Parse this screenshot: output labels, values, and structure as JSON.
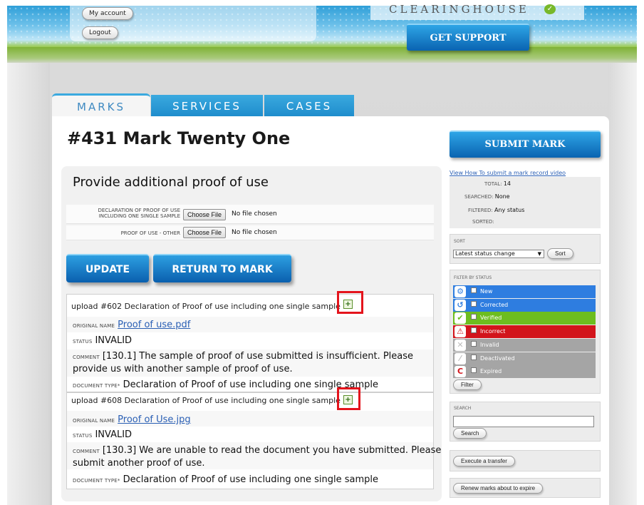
{
  "header": {
    "my_account": "My account",
    "logout": "Logout",
    "logo": "CLEARINGHOUSE",
    "logo_check": "✓",
    "get_support": "GET SUPPORT"
  },
  "tabs": [
    "MARKS",
    "SERVICES",
    "CASES"
  ],
  "page_title": "#431 Mark Twenty One",
  "proof": {
    "title": "Provide additional proof of use",
    "fields": [
      {
        "label_line1": "Declaration of proof of use",
        "label_line2": "including one single sample",
        "button": "Choose File",
        "file": "No file chosen"
      },
      {
        "label": "Proof of use - other",
        "button": "Choose File",
        "file": "No file chosen"
      }
    ],
    "update": "UPDATE",
    "return": "RETURN TO MARK"
  },
  "uploads": [
    {
      "heading": "upload #602 Declaration of Proof of use including one single sample",
      "plus": "+",
      "original_name_label": "Original name",
      "original_name": "Proof of use.pdf",
      "status_label": "Status",
      "status": "INVALID",
      "comment_label": "Comment",
      "comment_line1": "[130.1] The sample of proof of use submitted is insufficient. Please",
      "comment_line2": "provide us with another sample of proof of use.",
      "doctype_label": "Document type*",
      "doctype": "Declaration of Proof of use including one single sample"
    },
    {
      "heading": "upload #608 Declaration of Proof of use including one single sample",
      "plus": "+",
      "original_name_label": "Original name",
      "original_name": "Proof of Use.jpg",
      "status_label": "Status",
      "status": "INVALID",
      "comment_label": "Comment",
      "comment_line1": "[130.3] We are unable to read the document you have submitted. Please",
      "comment_line2": "submit another proof of use.",
      "doctype_label": "Document type*",
      "doctype": "Declaration of Proof of use including one single sample"
    }
  ],
  "sidebar": {
    "submit_mark": "SUBMIT MARK",
    "video_link": "View How To submit a mark record video",
    "stats": {
      "total_label": "Total:",
      "total": "14",
      "searched_label": "Searched:",
      "searched": "None",
      "filtered_label": "Filtered:",
      "filtered": "Any status",
      "sorted_label": "Sorted:"
    },
    "sort": {
      "title": "Sort",
      "selected": "Latest status change",
      "arrow": "▼",
      "button": "Sort"
    },
    "filter": {
      "title": "Filter by status",
      "statuses": [
        {
          "label": "New",
          "color": "#2e7de0",
          "icon": "gear-icon",
          "glyph": "⚙"
        },
        {
          "label": "Corrected",
          "color": "#2e7de0",
          "icon": "refresh-icon",
          "glyph": "↺"
        },
        {
          "label": "Verified",
          "color": "#6dbd1f",
          "icon": "check-icon",
          "glyph": "✔"
        },
        {
          "label": "Incorrect",
          "color": "#d2141b",
          "icon": "warning-icon",
          "glyph": "⚠"
        },
        {
          "label": "Invalid",
          "color": "#a5a5a5",
          "icon": "x-icon",
          "glyph": "✕"
        },
        {
          "label": "Deactivated",
          "color": "#a5a5a5",
          "icon": "slash-icon",
          "glyph": "⁄"
        },
        {
          "label": "Expired",
          "color": "#a5a5a5",
          "icon": "expired-icon",
          "glyph": "C"
        }
      ],
      "button": "Filter"
    },
    "search": {
      "title": "Search",
      "value": "",
      "button": "Search"
    },
    "execute_transfer": "Execute a transfer",
    "renew": "Renew marks about to expire"
  }
}
